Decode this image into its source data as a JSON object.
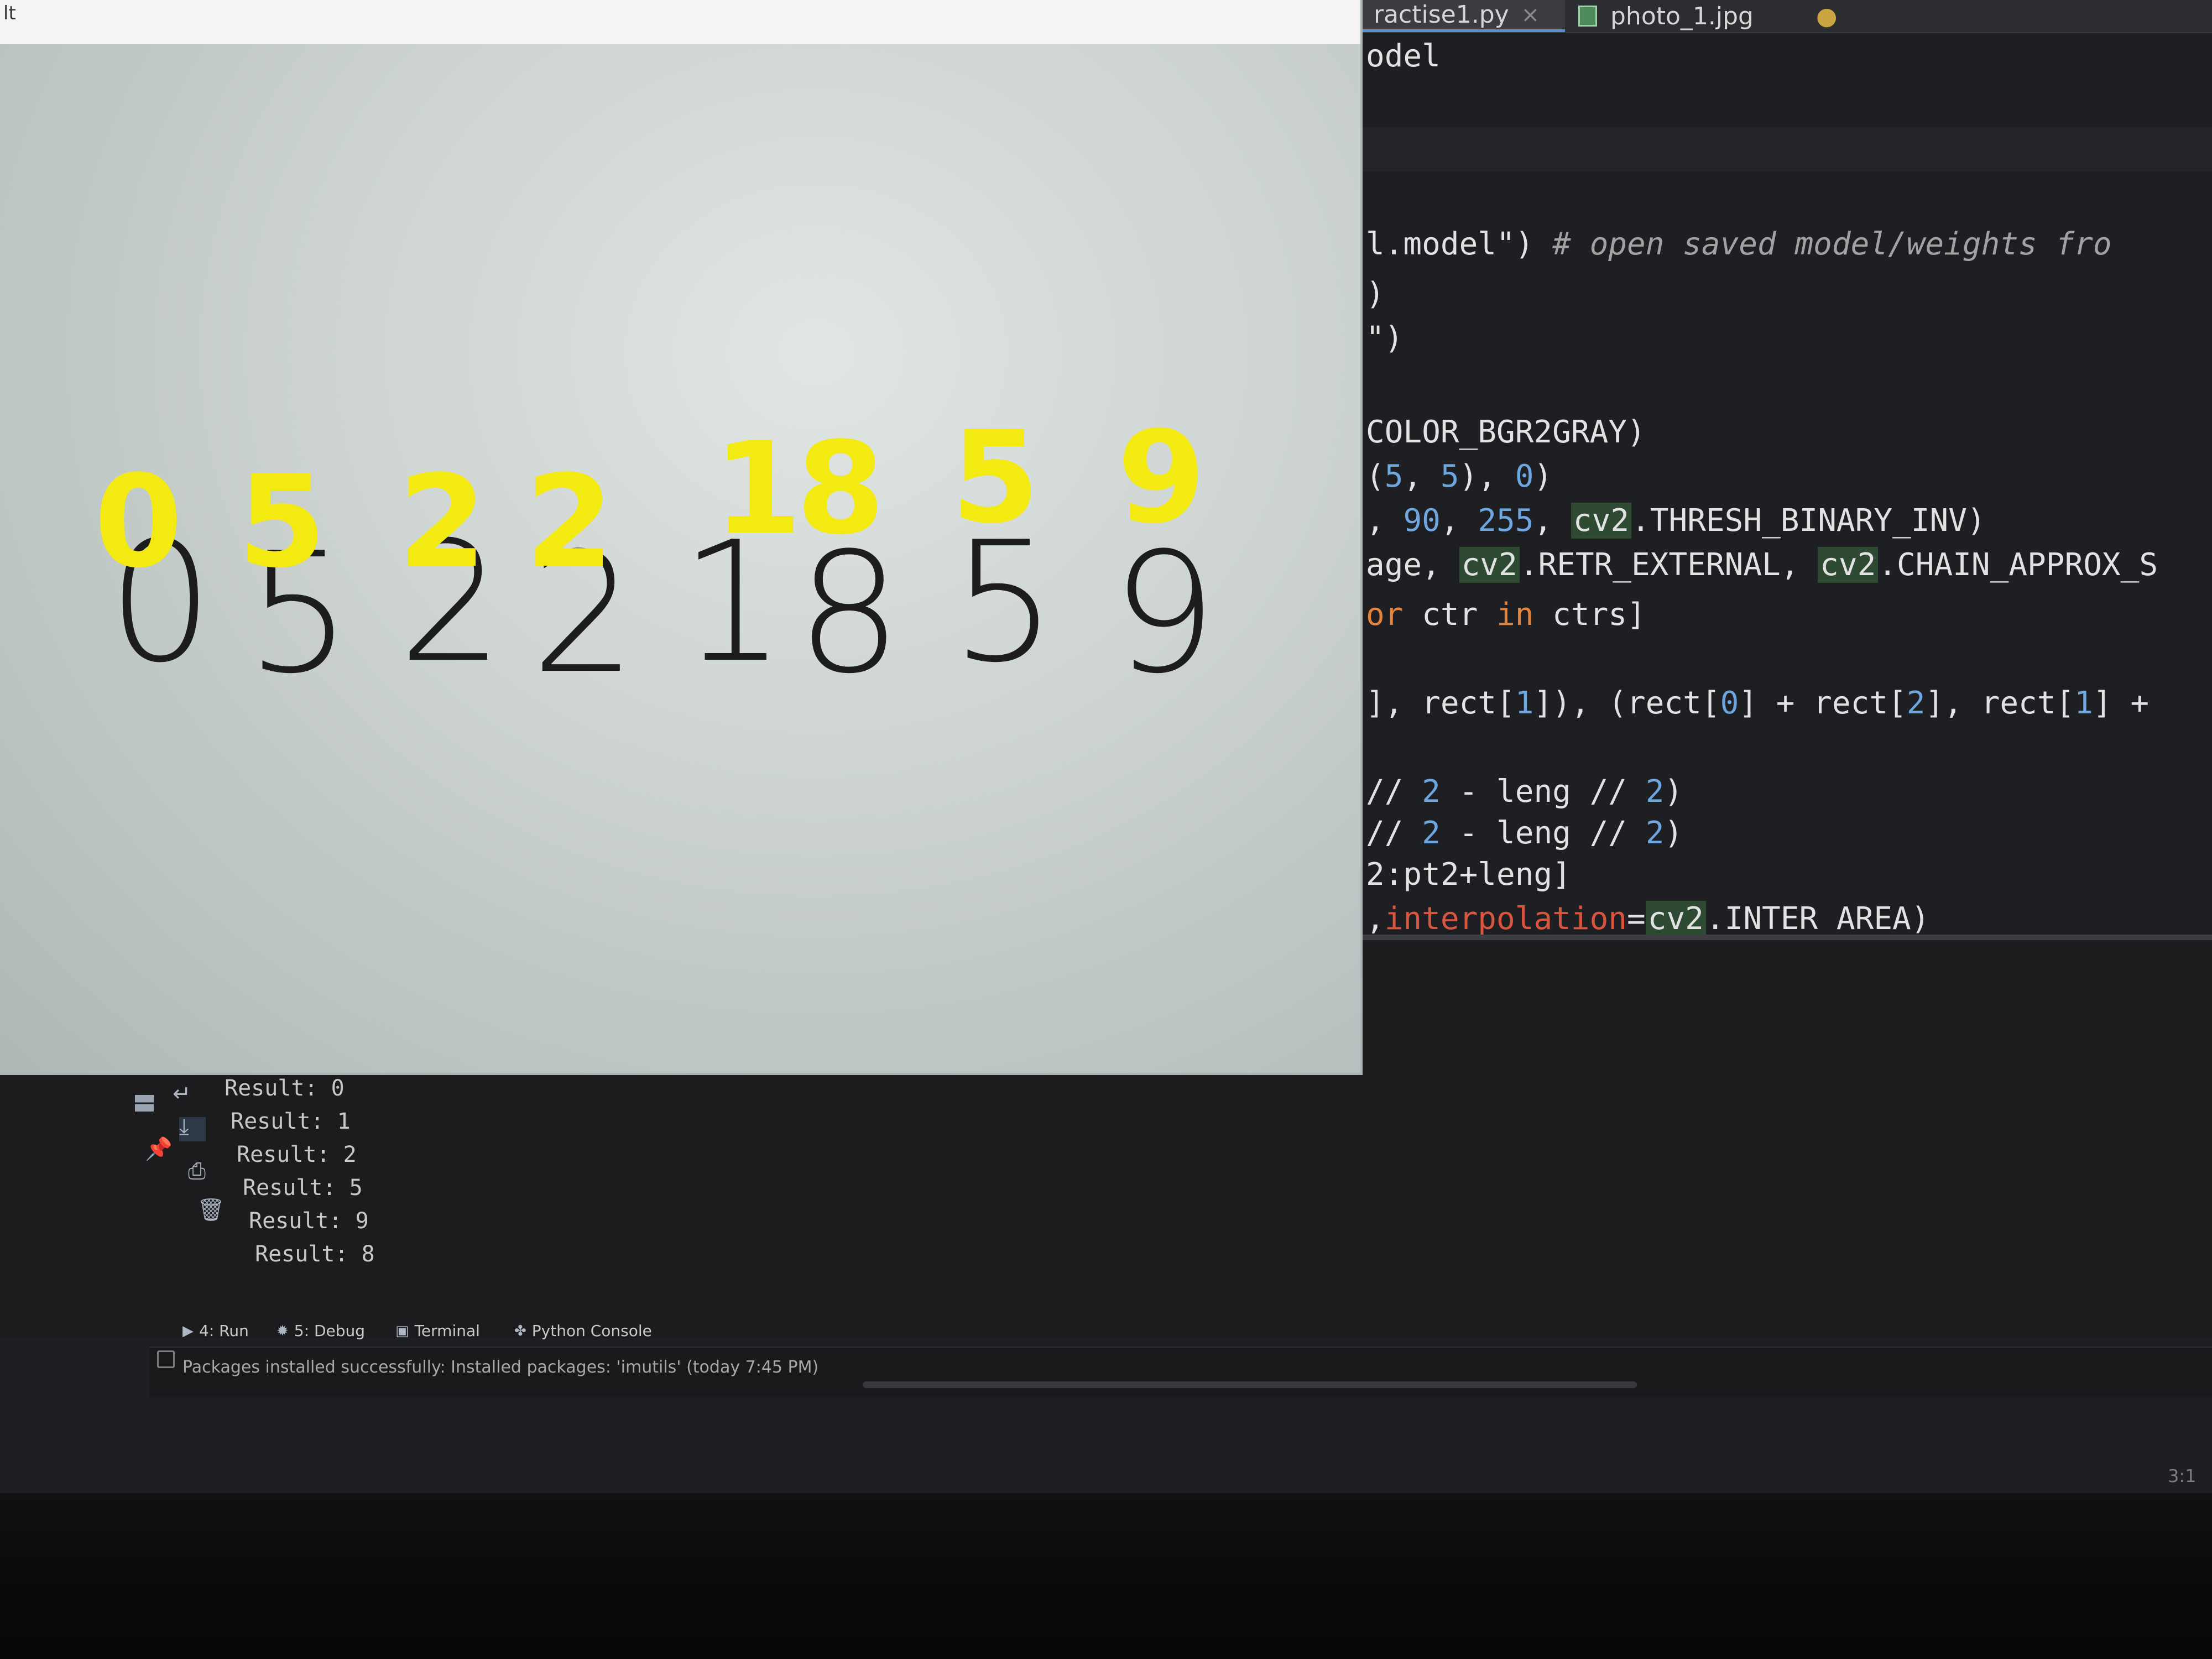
{
  "editor": {
    "tabs": [
      {
        "label": "ractise1.py",
        "close": "×"
      },
      {
        "label": "photo_1.jpg"
      },
      {
        "label": "●"
      }
    ],
    "code_lines": [
      {
        "parts": [
          {
            "t": "odel",
            "c": ""
          }
        ]
      },
      {
        "parts": [
          {
            "t": "l.model\")",
            "c": ""
          },
          {
            "t": " # open saved model/weights fro",
            "c": "cm"
          }
        ]
      },
      {
        "parts": [
          {
            "t": ")",
            "c": ""
          }
        ]
      },
      {
        "parts": [
          {
            "t": "\")",
            "c": ""
          }
        ]
      },
      {
        "parts": [
          {
            "t": "COLOR_BGR2GRAY)",
            "c": ""
          }
        ]
      },
      {
        "parts": [
          {
            "t": "(",
            "c": ""
          },
          {
            "t": "5",
            "c": "n"
          },
          {
            "t": ", ",
            "c": ""
          },
          {
            "t": "5",
            "c": "n"
          },
          {
            "t": "), ",
            "c": ""
          },
          {
            "t": "0",
            "c": "n"
          },
          {
            "t": ")",
            "c": ""
          }
        ]
      },
      {
        "parts": [
          {
            "t": ", ",
            "c": ""
          },
          {
            "t": "90",
            "c": "n"
          },
          {
            "t": ", ",
            "c": ""
          },
          {
            "t": "255",
            "c": "n"
          },
          {
            "t": ", ",
            "c": ""
          },
          {
            "t": "cv2",
            "c": "mod"
          },
          {
            "t": ".THRESH_BINARY_INV)",
            "c": ""
          }
        ]
      },
      {
        "parts": [
          {
            "t": "age, ",
            "c": ""
          },
          {
            "t": "cv2",
            "c": "mod"
          },
          {
            "t": ".RETR_EXTERNAL, ",
            "c": ""
          },
          {
            "t": "cv2",
            "c": "mod"
          },
          {
            "t": ".CHAIN_APPROX_S",
            "c": ""
          }
        ]
      },
      {
        "parts": [
          {
            "t": "or",
            "c": "k"
          },
          {
            "t": " ctr ",
            "c": ""
          },
          {
            "t": "in",
            "c": "k"
          },
          {
            "t": " ctrs]",
            "c": ""
          }
        ]
      },
      {
        "parts": [
          {
            "t": "], rect[",
            "c": ""
          },
          {
            "t": "1",
            "c": "n"
          },
          {
            "t": "]), (rect[",
            "c": ""
          },
          {
            "t": "0",
            "c": "n"
          },
          {
            "t": "] + rect[",
            "c": ""
          },
          {
            "t": "2",
            "c": "n"
          },
          {
            "t": "], rect[",
            "c": ""
          },
          {
            "t": "1",
            "c": "n"
          },
          {
            "t": "] +",
            "c": ""
          }
        ]
      },
      {
        "parts": [
          {
            "t": "// ",
            "c": ""
          },
          {
            "t": "2",
            "c": "n"
          },
          {
            "t": " - leng // ",
            "c": ""
          },
          {
            "t": "2",
            "c": "n"
          },
          {
            "t": ")",
            "c": ""
          }
        ]
      },
      {
        "parts": [
          {
            "t": "// ",
            "c": ""
          },
          {
            "t": "2",
            "c": "n"
          },
          {
            "t": " - leng // ",
            "c": ""
          },
          {
            "t": "2",
            "c": "n"
          },
          {
            "t": ")",
            "c": ""
          }
        ]
      },
      {
        "parts": [
          {
            "t": "2:pt2+leng]",
            "c": ""
          }
        ]
      },
      {
        "parts": [
          {
            "t": ",",
            "c": ""
          },
          {
            "t": "interpolation",
            "c": "red"
          },
          {
            "t": "=",
            "c": ""
          },
          {
            "t": "cv2",
            "c": "mod"
          },
          {
            "t": ".INTER_AREA)",
            "c": ""
          }
        ]
      }
    ]
  },
  "cv_window": {
    "title": "lt",
    "handwritten_digits": [
      "0",
      "5",
      "2",
      "2",
      "1",
      "8",
      "5",
      "9"
    ],
    "predicted_digits": [
      "0",
      "5",
      "2",
      "2",
      "1",
      "8",
      "5",
      "9"
    ],
    "prediction_color": "#f2ea10"
  },
  "run": {
    "results": [
      "Result: 5",
      "Result: 0",
      "Result: 1",
      "Result: 2",
      "Result: 5",
      "Result: 9",
      "Result: 8"
    ]
  },
  "tool_tabs": [
    {
      "label": "4: Run",
      "icon": "run-icon"
    },
    {
      "label": "5: Debug",
      "icon": "bug-icon"
    },
    {
      "label": "Terminal",
      "icon": "terminal-icon"
    },
    {
      "label": "Python Console",
      "icon": "python-icon"
    }
  ],
  "status": {
    "text": "Packages installed successfully: Installed packages: 'imutils' (today 7:45 PM)",
    "caret": "3:1"
  },
  "colors": {
    "editor_bg": "#1e1f22",
    "keyword": "#e6833a",
    "number": "#6ea6e0",
    "stop": "#d3242a"
  }
}
